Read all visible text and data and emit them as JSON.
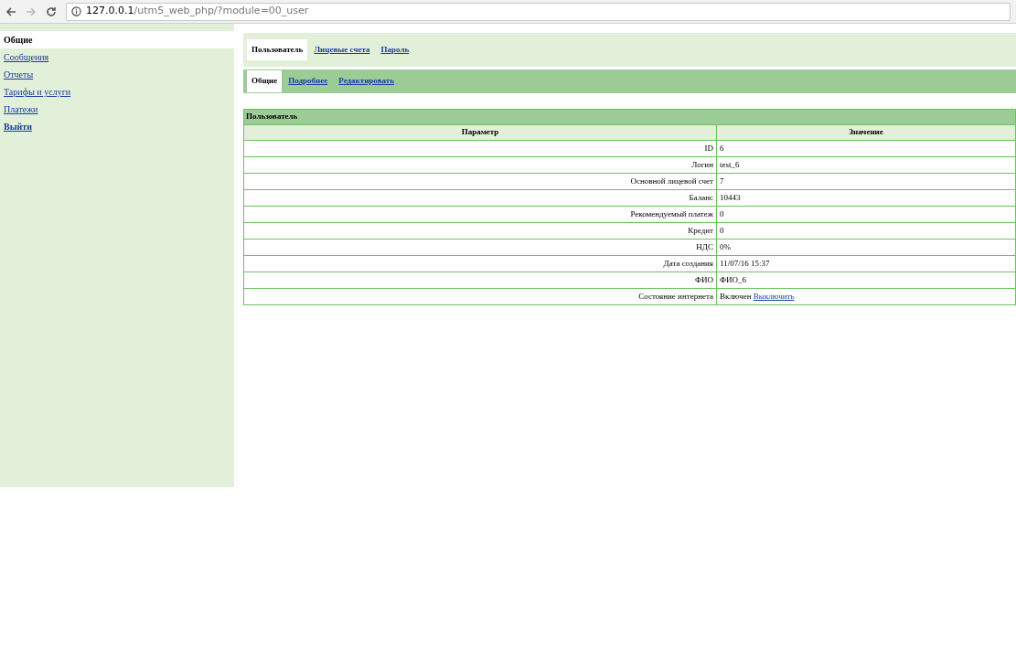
{
  "browser": {
    "url_host": "127.0.0.1",
    "url_path": "/utm5_web_php/?module=00_user"
  },
  "sidebar": {
    "items": [
      {
        "label": "Общие",
        "kind": "link",
        "selected": true
      },
      {
        "label": "Сообщения",
        "kind": "link",
        "selected": false
      },
      {
        "label": "Отчеты",
        "kind": "link",
        "selected": false
      },
      {
        "label": "Тарифы и услуги",
        "kind": "link",
        "selected": false
      },
      {
        "label": "Платежи",
        "kind": "link",
        "selected": false
      },
      {
        "label": "Выйти",
        "kind": "logout",
        "selected": false
      }
    ]
  },
  "tabs": [
    {
      "label": "Пользователь",
      "selected": true
    },
    {
      "label": "Лицевые счета",
      "selected": false
    },
    {
      "label": "Пароль",
      "selected": false
    }
  ],
  "subtabs": [
    {
      "label": "Общие",
      "selected": true
    },
    {
      "label": "Подробнее",
      "selected": false
    },
    {
      "label": "Редактировать",
      "selected": false
    }
  ],
  "table": {
    "title": "Пользователь",
    "columns": [
      "Параметр",
      "Значение"
    ],
    "rows": [
      {
        "param": "ID",
        "value": "6"
      },
      {
        "param": "Логин",
        "value": "test_6"
      },
      {
        "param": "Основной лицевой счет",
        "value": "7"
      },
      {
        "param": "Баланс",
        "value": "10443"
      },
      {
        "param": "Рекомендуемый платеж",
        "value": "0"
      },
      {
        "param": "Кредит",
        "value": "0"
      },
      {
        "param": "НДС",
        "value": "0%"
      },
      {
        "param": "Дата создания",
        "value": "11/07/16 15:37"
      },
      {
        "param": "ФИО",
        "value": "ФИО_6"
      },
      {
        "param": "Состояние интернета",
        "value": "Включен",
        "action": "Выключить"
      }
    ]
  }
}
